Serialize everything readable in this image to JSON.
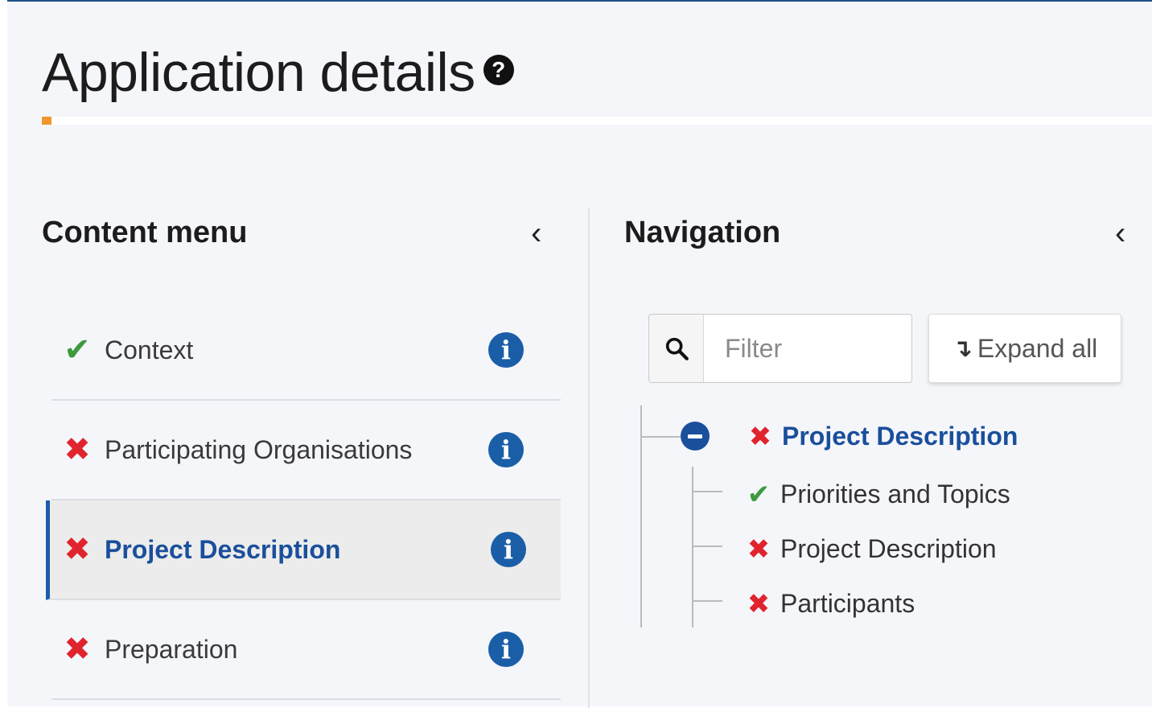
{
  "page": {
    "title": "Application details",
    "help_icon": "?"
  },
  "content_menu": {
    "title": "Content menu",
    "collapse_icon": "‹",
    "items": [
      {
        "label": "Context",
        "status": "complete",
        "status_glyph": "✔",
        "info_glyph": "i"
      },
      {
        "label": "Participating Organisations",
        "status": "error",
        "status_glyph": "✖",
        "info_glyph": "i"
      },
      {
        "label": "Project Description",
        "status": "error",
        "status_glyph": "✖",
        "info_glyph": "i",
        "active": true
      },
      {
        "label": "Preparation",
        "status": "error",
        "status_glyph": "✖",
        "info_glyph": "i"
      }
    ]
  },
  "navigation": {
    "title": "Navigation",
    "collapse_icon": "‹",
    "filter_placeholder": "Filter",
    "expand_all_label": "Expand all",
    "expand_arrow": "↴",
    "tree": {
      "parent": {
        "label": "Project Description",
        "status": "error",
        "status_glyph": "✖"
      },
      "children": [
        {
          "label": "Priorities and Topics",
          "status": "complete",
          "status_glyph": "✔"
        },
        {
          "label": "Project Description",
          "status": "error",
          "status_glyph": "✖"
        },
        {
          "label": "Participants",
          "status": "error",
          "status_glyph": "✖"
        }
      ]
    }
  },
  "colors": {
    "accent_blue": "#1a5ea8",
    "active_text": "#1a4f9c",
    "success": "#3d9a3d",
    "error": "#e0242e",
    "title_accent": "#f0962d"
  }
}
